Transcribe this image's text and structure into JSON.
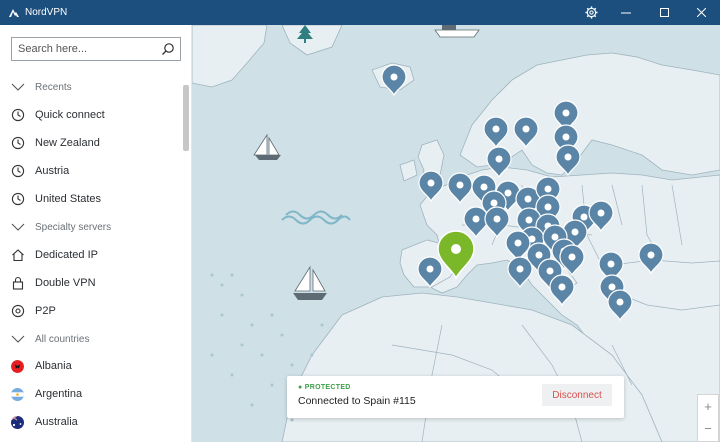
{
  "window": {
    "title": "NordVPN"
  },
  "sidebar": {
    "search_placeholder": "Search here...",
    "items": [
      {
        "label": "Recents",
        "type": "header",
        "icon": "chevron-down-icon"
      },
      {
        "label": "Quick connect",
        "type": "item",
        "icon": "clock-icon"
      },
      {
        "label": "New Zealand",
        "type": "item",
        "icon": "clock-icon"
      },
      {
        "label": "Austria",
        "type": "item",
        "icon": "clock-icon"
      },
      {
        "label": "United States",
        "type": "item",
        "icon": "clock-icon"
      },
      {
        "label": "Specialty servers",
        "type": "header",
        "icon": "chevron-down-icon"
      },
      {
        "label": "Dedicated IP",
        "type": "item",
        "icon": "home-icon"
      },
      {
        "label": "Double VPN",
        "type": "item",
        "icon": "lock-icon"
      },
      {
        "label": "P2P",
        "type": "item",
        "icon": "p2p-icon"
      },
      {
        "label": "All countries",
        "type": "header",
        "icon": "chevron-down-icon"
      },
      {
        "label": "Albania",
        "type": "item",
        "icon": "flag-albania-icon"
      },
      {
        "label": "Argentina",
        "type": "item",
        "icon": "flag-argentina-icon"
      },
      {
        "label": "Australia",
        "type": "item",
        "icon": "flag-australia-icon"
      }
    ]
  },
  "status": {
    "state": "PROTECTED",
    "connected_text": "Connected to Spain #115",
    "disconnect_label": "Disconnect"
  },
  "zoom": {
    "in_label": "+",
    "out_label": "−"
  },
  "colors": {
    "titlebar": "#1d4f7e",
    "map_water": "#cfe0e6",
    "map_land": "#e8eff2",
    "pin": "#5b85a6",
    "pin_active": "#7ab829",
    "protected": "#3ea04a",
    "disconnect": "#d9534f"
  }
}
